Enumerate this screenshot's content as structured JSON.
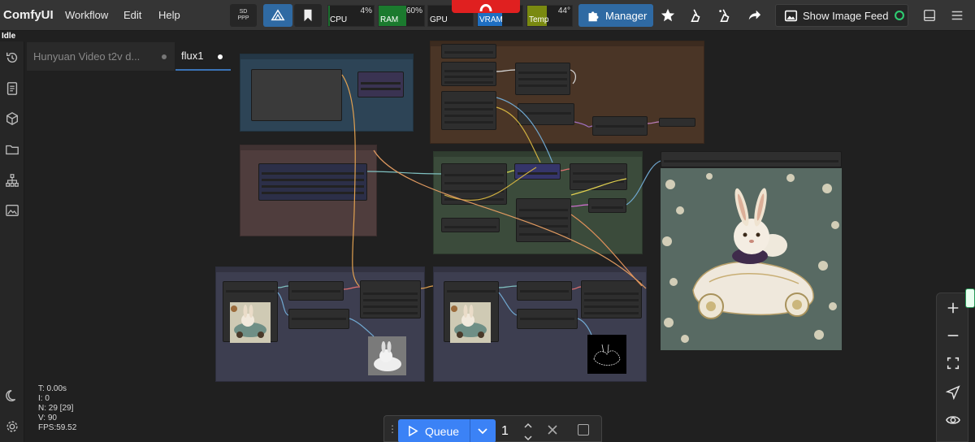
{
  "app": {
    "title": "ComfyUI",
    "menu": [
      "Workflow",
      "Edit",
      "Help"
    ],
    "status": "Idle"
  },
  "toolbar": {
    "sdppp_label": "SD\nPPP",
    "meters": [
      {
        "label": "CPU",
        "value": "4%",
        "fill": 0.04,
        "color": "#1b6e2e"
      },
      {
        "label": "RAM",
        "value": "60%",
        "fill": 0.6,
        "color": "#1b7a2e"
      },
      {
        "label": "GPU",
        "value": "",
        "fill": 0.0,
        "color": "#1b7a2e"
      },
      {
        "label": "VRAM",
        "value": "",
        "fill": 0.55,
        "color": "#1f6fc2"
      },
      {
        "label": "Temp",
        "value": "44°",
        "fill": 0.44,
        "color": "#7a8a10"
      }
    ],
    "manager_label": "Manager",
    "image_feed_label": "Show Image Feed",
    "accent": "#2f6aa3"
  },
  "tabs": [
    {
      "label": "Hunyuan Video t2v d...",
      "active": false
    },
    {
      "label": "flux1",
      "active": true
    }
  ],
  "stats": {
    "t": "T: 0.00s",
    "i": "I: 0",
    "n": "N: 29 [29]",
    "v": "V: 90",
    "fps": "FPS:59.52"
  },
  "queue": {
    "label": "Queue",
    "count": "1"
  },
  "sidebar_icons": [
    "history-icon",
    "document-icon",
    "cube-icon",
    "folder-icon",
    "workflow-tree-icon",
    "image-gallery-icon",
    "moon-icon",
    "settings-icon"
  ],
  "canvas_controls": [
    "zoom-in-icon",
    "zoom-out-icon",
    "fit-view-icon",
    "navigate-icon",
    "visibility-icon"
  ]
}
